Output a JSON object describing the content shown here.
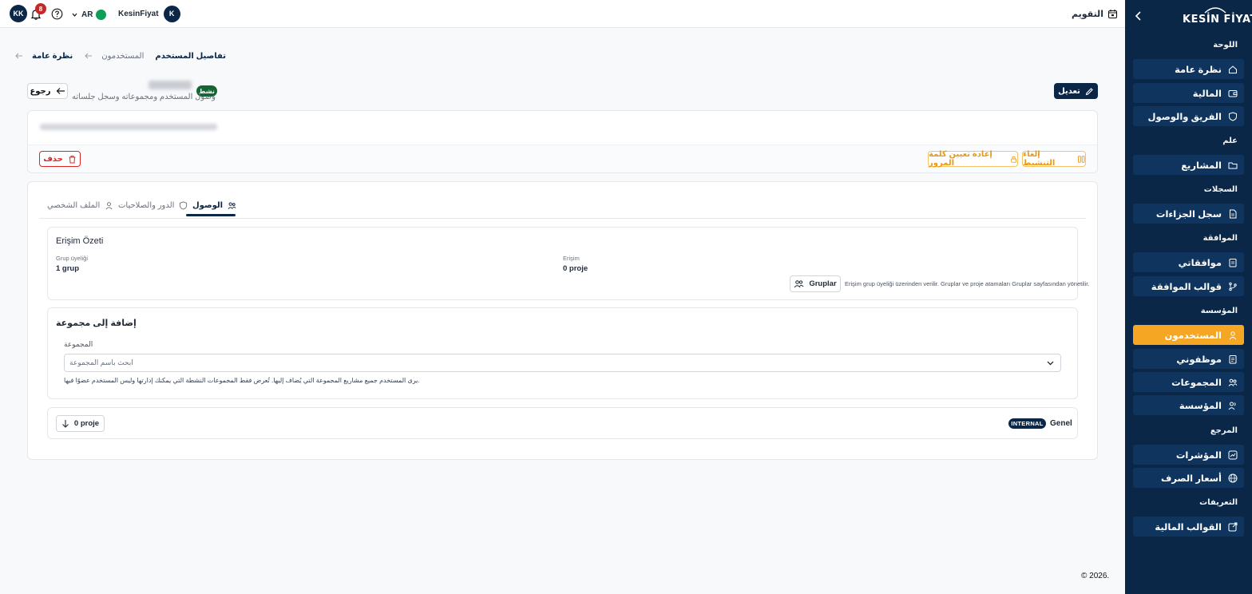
{
  "sidebar": {
    "logo": "KESİN FİYAT",
    "sections": [
      {
        "label": "اللوحة"
      },
      {
        "label": "علم"
      },
      {
        "label": "السجلات"
      },
      {
        "label": "الموافقة"
      },
      {
        "label": "المؤسسة"
      },
      {
        "label": "المرجع"
      },
      {
        "label": "التعريفات"
      }
    ],
    "items": [
      {
        "label": "نظرة عامة",
        "icon": "home-icon"
      },
      {
        "label": "المالية",
        "icon": "wallet-icon"
      },
      {
        "label": "الفريق والوصول",
        "icon": "shield-icon"
      },
      {
        "label": "المشاريع",
        "icon": "folder-icon"
      },
      {
        "label": "سجل الجزاءات",
        "icon": "file-icon"
      },
      {
        "label": "موافقاتي",
        "icon": "clipboard-icon"
      },
      {
        "label": "قوالب الموافقة",
        "icon": "branch-icon"
      },
      {
        "label": "المستخدمون",
        "icon": "user-icon",
        "active": true
      },
      {
        "label": "موظفوني",
        "icon": "clipboard-list-icon"
      },
      {
        "label": "المجموعات",
        "icon": "users-icon"
      },
      {
        "label": "المؤسسة",
        "icon": "users-icon"
      },
      {
        "label": "المؤشرات",
        "icon": "chart-icon"
      },
      {
        "label": "أسعار الصرف",
        "icon": "globe-icon"
      },
      {
        "label": "القوالب المالية",
        "icon": "external-icon"
      }
    ],
    "active_color": "#f5a623",
    "bg_color": "#0b2748"
  },
  "topbar": {
    "user_initials": "KK",
    "notifications": "8",
    "language": "AR",
    "org_name": "KesinFiyat",
    "org_initial": "K",
    "calendar_label": "التقويم"
  },
  "breadcrumb": {
    "overview": "نظرة عامة",
    "users": "المستخدمون",
    "current": "تفاصيل المستخدم"
  },
  "header": {
    "back_label": "رجوع",
    "edit_label": "تعديل",
    "status": "نشط",
    "subtitle": "وصول المستخدم ومجموعاته وسجل جلساته"
  },
  "actions": {
    "delete_label": "حذف",
    "reset_password_label": "إعادة تعيين كلمة المرور",
    "deactivate_label": "إلغاء التنشيط"
  },
  "tabs": [
    {
      "label": "الوصول",
      "active": true,
      "icon": "users-icon"
    },
    {
      "label": "الدور والصلاحيات",
      "icon": "shield-icon"
    },
    {
      "label": "الملف الشخصي",
      "icon": "user-icon"
    }
  ],
  "access_summary": {
    "title": "Erişim Özeti",
    "group_label": "Grup üyeliği",
    "group_value": "1 grup",
    "access_label": "Erişim",
    "access_value": "0 proje",
    "groups_button": "Gruplar",
    "note": "Erişim grup üyeliği üzerinden verilir. Gruplar ve proje atamaları Gruplar sayfasından yönetilir."
  },
  "add_group": {
    "title": "إضافة إلى مجموعة",
    "field_label": "المجموعة",
    "placeholder": "ابحث باسم المجموعة",
    "help": "يرى المستخدم جميع مشاريع المجموعة التي يُضاف إليها. تُعرض فقط المجموعات النشطة التي يمكنك إدارتها وليس المستخدم عضوًا فيها."
  },
  "group_row": {
    "name": "Genel",
    "type": "INTERNAL",
    "projects_button": "0 proje"
  },
  "footer": {
    "copyright": "© 2026."
  }
}
